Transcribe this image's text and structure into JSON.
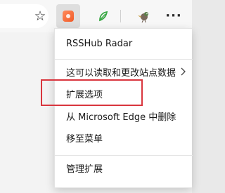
{
  "toolbar": {
    "icons": [
      "star-icon",
      "rsshub-radar-icon",
      "leaf-icon",
      "bird-icon",
      "more-icon"
    ],
    "more_glyph": "···",
    "star_glyph": "☆"
  },
  "menu": {
    "items": [
      {
        "label": "RSSHub Radar"
      },
      {
        "label": "这可以读取和更改站点数据"
      },
      {
        "label": "扩展选项"
      },
      {
        "label": "从 Microsoft Edge 中删除"
      },
      {
        "label": "移至菜单"
      },
      {
        "label": "管理扩展"
      }
    ]
  },
  "colors": {
    "highlight": "#d9363e",
    "menu_background": "#ffffff",
    "toolbar_background": "#f7f7f7"
  }
}
